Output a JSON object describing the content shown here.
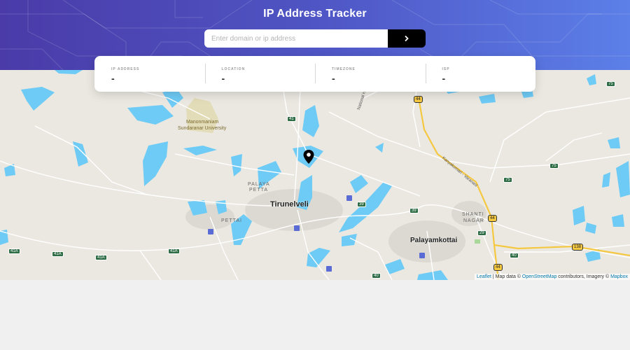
{
  "header": {
    "title": "IP Address Tracker"
  },
  "search": {
    "placeholder": "Enter domain or ip address",
    "value": "",
    "button_icon": "chevron-right-icon"
  },
  "info": {
    "ip": {
      "label": "IP ADDRESS",
      "value": "-"
    },
    "location": {
      "label": "LOCATION",
      "value": "-"
    },
    "timezone": {
      "label": "TIMEZONE",
      "value": "-"
    },
    "isp": {
      "label": "ISP",
      "value": "-"
    }
  },
  "map": {
    "places": {
      "tirunelveli": "Tirunelveli",
      "palayamkottai": "Palayamkottai",
      "pettai": "PETTAI",
      "palaya_petta_1": "PALAYA",
      "palaya_petta_2": "PETTA",
      "shanti_nagar_1": "SHANTI",
      "shanti_nagar_2": "NAGAR",
      "university_1": "Manonmaniam",
      "university_2": "Sundaranar University",
      "road_label_1": "Kanyakumari - Varanasi",
      "road_label_2": "National H"
    },
    "shields": [
      "41",
      "41A",
      "41A",
      "41A",
      "41A",
      "44",
      "44",
      "44",
      "39",
      "39",
      "29",
      "40",
      "40",
      "75",
      "75",
      "75",
      "138"
    ],
    "attribution": {
      "leaflet": "Leaflet",
      "sep": " | Map data © ",
      "osm": "OpenStreetMap",
      "mid": " contributors, Imagery © ",
      "mapbox": "Mapbox"
    }
  },
  "colors": {
    "water": "#6ecbf5",
    "land": "#ebe8e1",
    "highway": "#f5c842",
    "marker": "#000000"
  }
}
